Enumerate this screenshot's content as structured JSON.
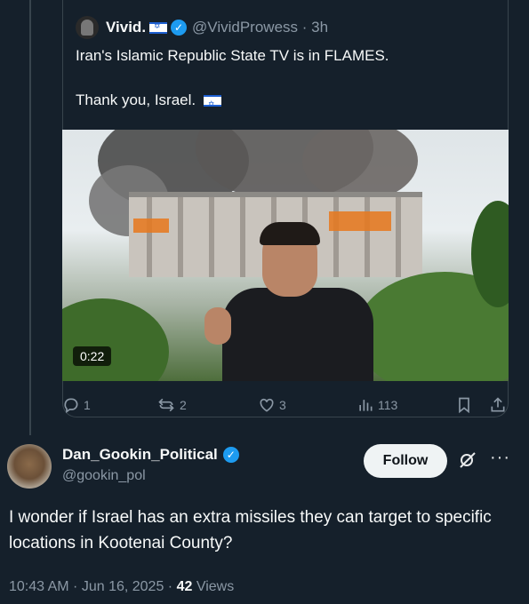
{
  "quoted_tweet": {
    "display_name": "Vivid.",
    "handle": "@VividProwess",
    "time": "3h",
    "line1": "Iran's Islamic Republic State TV is in FLAMES.",
    "line2": "Thank you, Israel.",
    "video_duration": "0:22"
  },
  "actions": {
    "replies": "1",
    "reposts": "2",
    "likes": "3",
    "views": "113"
  },
  "reply_tweet": {
    "display_name": "Dan_Gookin_Political",
    "handle": "@gookin_pol",
    "follow_label": "Follow",
    "text": "I wonder if Israel has an extra missiles they can target to specific locations in Kootenai County?",
    "timestamp": "10:43 AM · Jun 16, 2025",
    "views_count": "42",
    "views_label": "Views"
  },
  "colors": {
    "background": "#15202b",
    "accent": "#1d9bf0",
    "muted_text": "#8b98a5",
    "border": "#38444d"
  },
  "icons": [
    "flag-israel-icon",
    "verified-badge-icon",
    "reply-icon",
    "repost-icon",
    "like-icon",
    "views-icon",
    "bookmark-icon",
    "share-icon",
    "grok-icon",
    "more-icon"
  ]
}
